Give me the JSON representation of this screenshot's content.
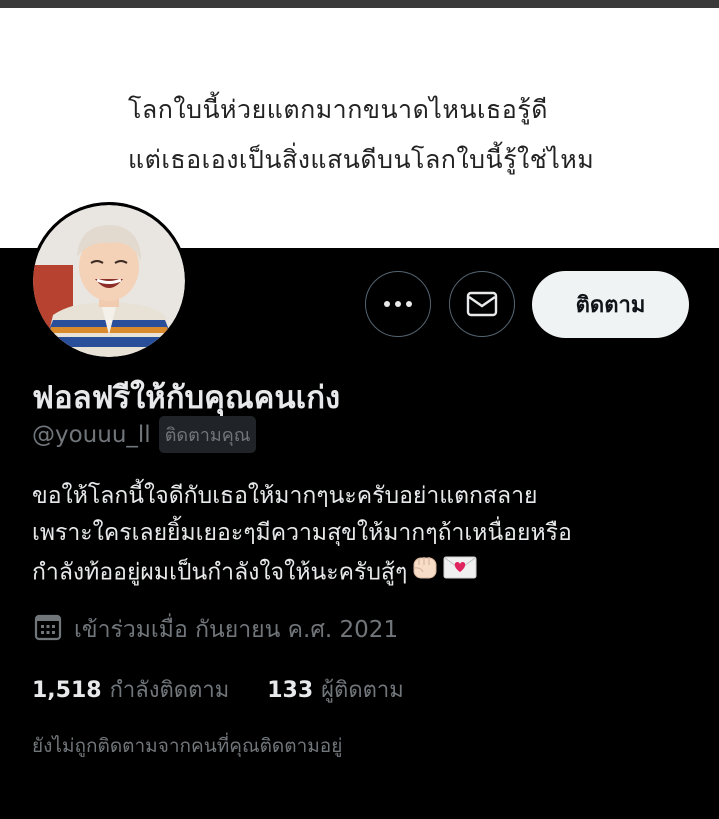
{
  "banner": {
    "line1": "โลกใบนี้ห่วยแตกมากขนาดไหนเธอรู้ดี",
    "line2": "แต่เธอเองเป็นสิ่งแสนดีบนโลกใบนี้รู้ใช่ไหม"
  },
  "actions": {
    "more_icon": "more-horizontal-icon",
    "message_icon": "envelope-icon",
    "follow_label": "ติดตาม"
  },
  "profile": {
    "display_name": "ฟอลฟรีให้กับคุณคนเก่ง",
    "handle": "@youuu_ll",
    "follows_you": "ติดตามคุณ",
    "bio_lines": [
      "ขอให้โลกนี้ใจดีกับเธอให้มากๆนะครับอย่าแตกสลาย",
      "เพราะใครเลยยิ้มเยอะๆมีความสุขให้มากๆถ้าเหนื่อยหรือ",
      "กำลังท้ออยู่ผมเป็นกำลังใจให้นะครับสู้ๆ"
    ],
    "bio_emojis": [
      "raised-fist-emoji",
      "love-letter-emoji"
    ],
    "joined": "เข้าร่วมเมื่อ กันยายน ค.ศ. 2021",
    "joined_icon": "calendar-icon"
  },
  "stats": {
    "following_count": "1,518",
    "following_label": "กำลังติดตาม",
    "followers_count": "133",
    "followers_label": "ผู้ติดตาม"
  },
  "footer_note": "ยังไม่ถูกติดตามจากคนที่คุณติดตามอยู่",
  "colors": {
    "background": "#000000",
    "primary_text": "#e7e9ea",
    "secondary_text": "#71767b",
    "button_border": "#536471",
    "follow_button_bg": "#eff3f4"
  }
}
